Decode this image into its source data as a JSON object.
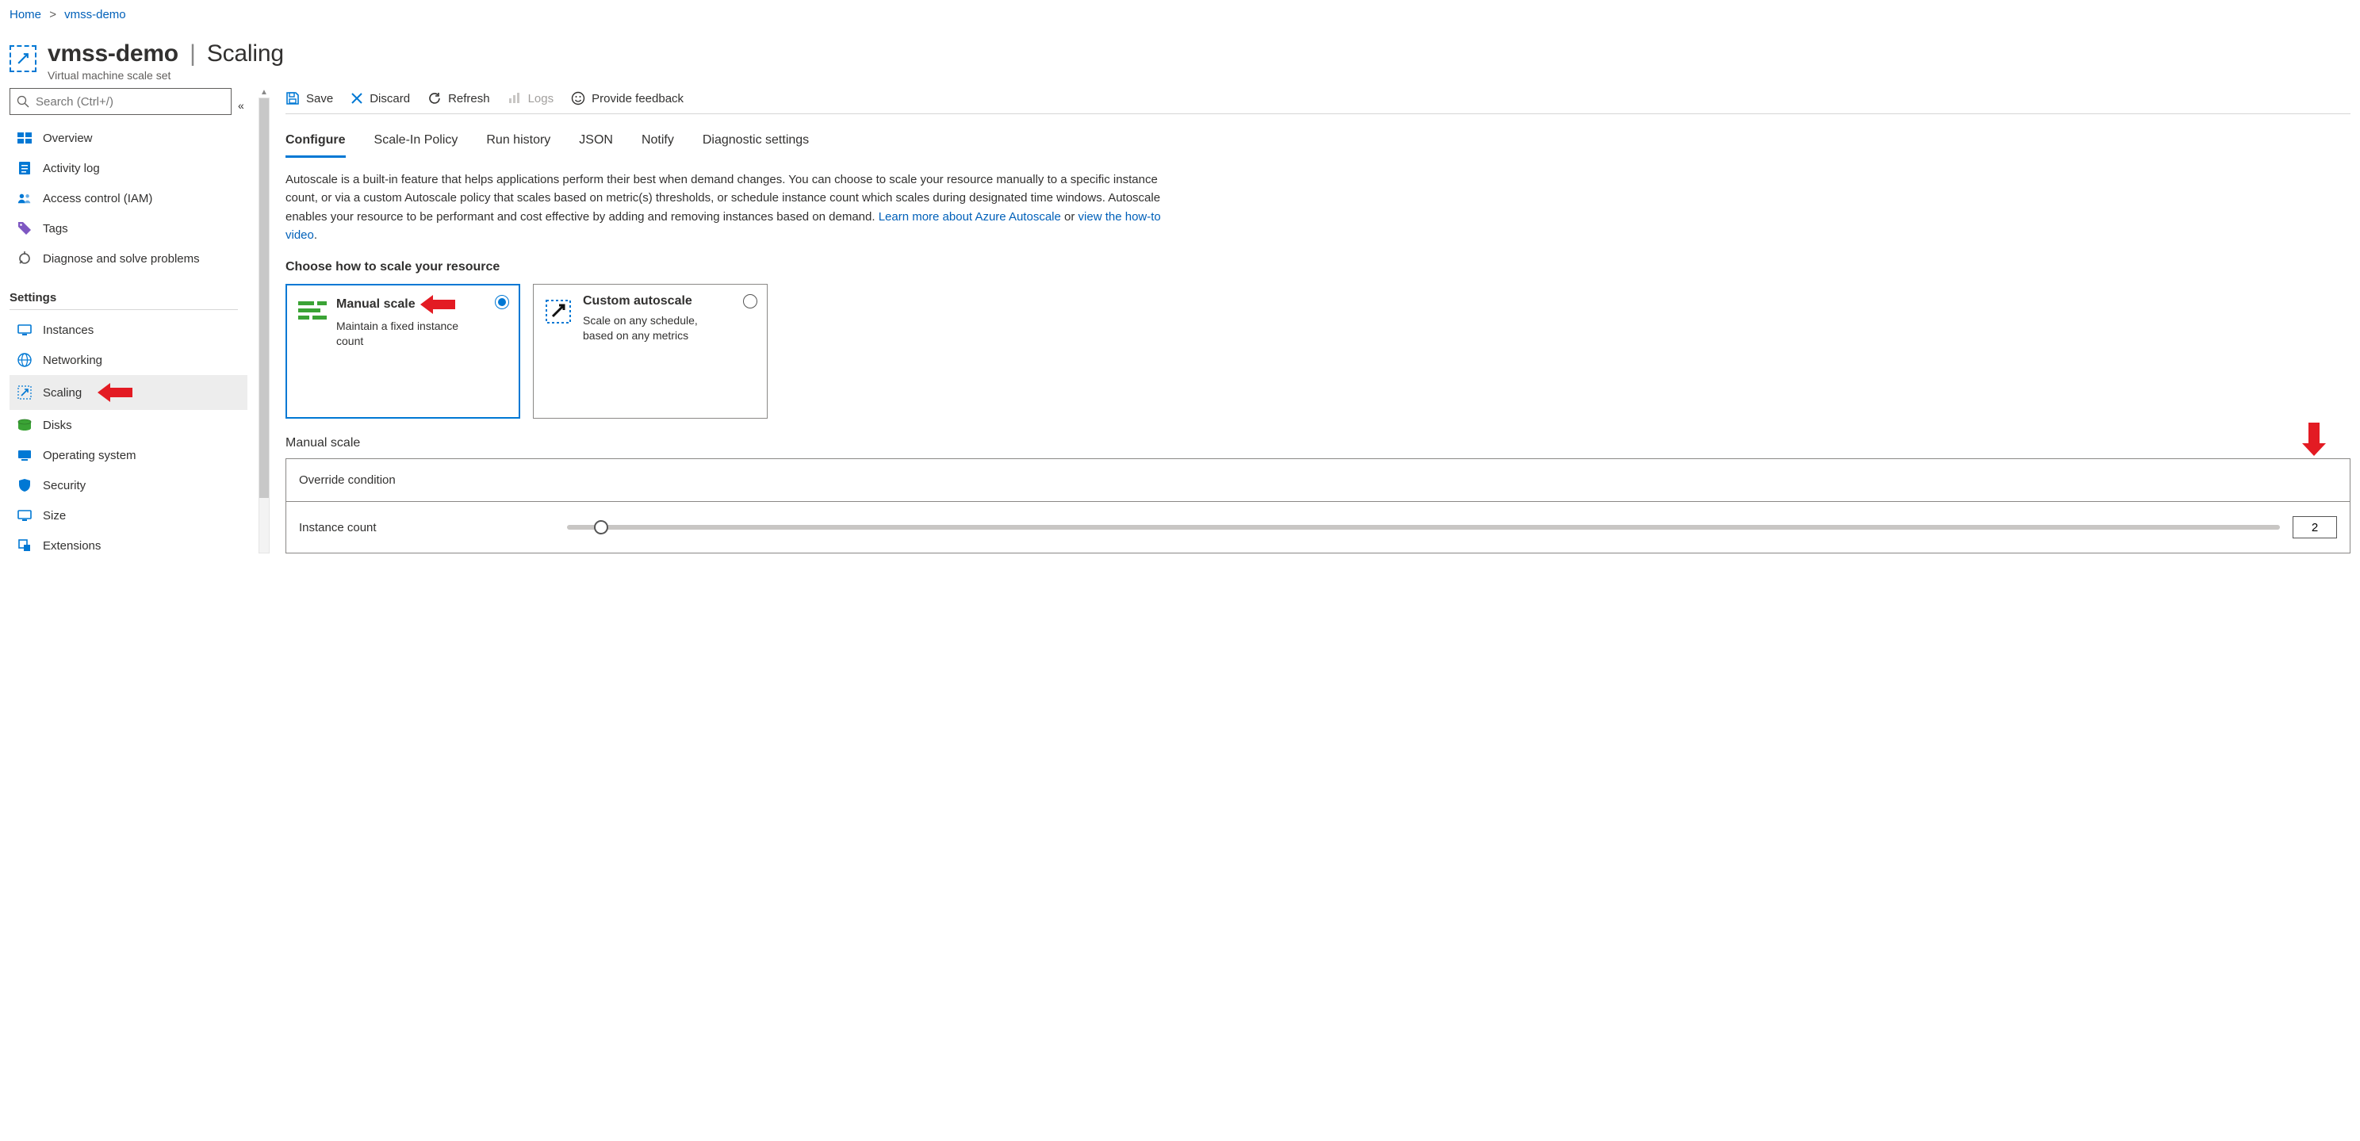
{
  "breadcrumb": {
    "home": "Home",
    "resource": "vmss-demo"
  },
  "header": {
    "resource_name": "vmss-demo",
    "page_name": "Scaling",
    "resource_type": "Virtual machine scale set"
  },
  "search": {
    "placeholder": "Search (Ctrl+/)"
  },
  "nav": {
    "top": [
      {
        "label": "Overview"
      },
      {
        "label": "Activity log"
      },
      {
        "label": "Access control (IAM)"
      },
      {
        "label": "Tags"
      },
      {
        "label": "Diagnose and solve problems"
      }
    ],
    "settings_label": "Settings",
    "settings": [
      {
        "label": "Instances"
      },
      {
        "label": "Networking"
      },
      {
        "label": "Scaling"
      },
      {
        "label": "Disks"
      },
      {
        "label": "Operating system"
      },
      {
        "label": "Security"
      },
      {
        "label": "Size"
      },
      {
        "label": "Extensions"
      }
    ]
  },
  "toolbar": {
    "save": "Save",
    "discard": "Discard",
    "refresh": "Refresh",
    "logs": "Logs",
    "feedback": "Provide feedback"
  },
  "tabs": {
    "configure": "Configure",
    "scale_in": "Scale-In Policy",
    "run_history": "Run history",
    "json": "JSON",
    "notify": "Notify",
    "diagnostic": "Diagnostic settings"
  },
  "intro": {
    "text_1": "Autoscale is a built-in feature that helps applications perform their best when demand changes. You can choose to scale your resource manually to a specific instance count, or via a custom Autoscale policy that scales based on metric(s) thresholds, or schedule instance count which scales during designated time windows. Autoscale enables your resource to be performant and cost effective by adding and removing instances based on demand. ",
    "link_learn": "Learn more about Azure Autoscale",
    "text_or": " or ",
    "link_video": "view the how-to video",
    "period": "."
  },
  "choose_heading": "Choose how to scale your resource",
  "cards": {
    "manual": {
      "title": "Manual scale",
      "desc": "Maintain a fixed instance count"
    },
    "custom": {
      "title": "Custom autoscale",
      "desc": "Scale on any schedule, based on any metrics"
    }
  },
  "manual_section": {
    "heading": "Manual scale",
    "override_label": "Override condition",
    "instance_label": "Instance count",
    "instance_value": "2"
  }
}
